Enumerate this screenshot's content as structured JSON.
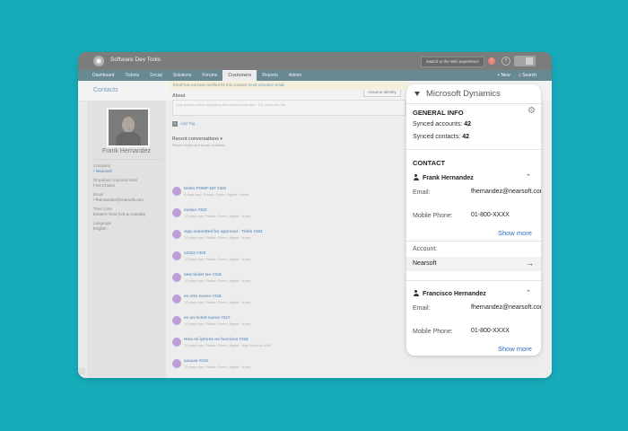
{
  "app": {
    "title": "Software Dev Tools",
    "switch_label": "Switch to the Wiki experience",
    "alert_glyph": "!",
    "help_glyph": "?"
  },
  "nav": {
    "items": [
      "Dashboard",
      "Tickets",
      "Social",
      "Solutions",
      "Forums",
      "Customers",
      "Reports",
      "Admin"
    ],
    "active": "Customers",
    "new_label": "+ New",
    "search_label": "Search"
  },
  "page": {
    "section_title": "Contacts",
    "assume_identity_label": "Assume identity"
  },
  "contact_left": {
    "name": "Frank Hernandez",
    "company_label": "Company",
    "company_value": "Nearsoft",
    "dropdown_label": "Dropdown required label",
    "dropdown_value": "First Choice",
    "email_label": "Email",
    "email_value": "fhernandez@nearsoft.com",
    "timezone_label": "Time zone",
    "timezone_value": "Eastern Time (US & Canada)",
    "language_label": "Language",
    "language_value": "English"
  },
  "main": {
    "email_warning": "Email has not been verified for this contact!",
    "email_warning_link": "Send activation email",
    "about_label": "About",
    "about_placeholder": "Add specific notes regarding this contact example - CA, takes fan etc.",
    "add_tag_label": "Add Tag",
    "recent_title": "Recent conversations",
    "recent_sub": "Recent ticket and forum activities",
    "tickets": [
      {
        "title": "testin PONP-167 #322",
        "meta": "5 days ago, Status: Open  •  Agent : None"
      },
      {
        "title": "swdas #322",
        "meta": "12 days ago, Status: Open  •  Agent : None"
      },
      {
        "title": "App submitted for approval - Trello #321",
        "meta": "12 days ago, Status: Open  •  Agent : None"
      },
      {
        "title": "s2222 #320",
        "meta": "12 days ago, Status: Open  •  Agent : None"
      },
      {
        "title": "new ticket tes #319",
        "meta": "12 days ago, Status: Open  •  Agent : None"
      },
      {
        "title": "es otro nuevo #318",
        "meta": "12 days ago, Status: Open  •  Agent : None"
      },
      {
        "title": "es un ticket nuevo #317",
        "meta": "12 days ago, Status: Open  •  Agent : None"
      },
      {
        "title": "Hola mi iphone no funciona #316",
        "meta": "12 days ago, Status: Open  •  Agent : Axel Monroy LA50"
      },
      {
        "title": "aaaaaa #315",
        "meta": "12 days ago, Status: Open  •  Agent : None"
      }
    ]
  },
  "dynamics": {
    "title": "Microsoft Dynamics",
    "general_info": "GENERAL INFO",
    "synced_accounts_label": "Synced accounts:",
    "synced_accounts_value": "42",
    "synced_contacts_label": "Synced contacts:",
    "synced_contacts_value": "42",
    "contact_header": "CONTACT",
    "contacts": [
      {
        "name": "Frank Hernandez",
        "email_label": "Email:",
        "email_value": "fhernandez@nearsoft.com",
        "phone_label": "Mobile Phone:",
        "phone_value": "01-800-XXXX",
        "show_more": "Show more",
        "account_label": "Account:",
        "account_value": "Nearsoft"
      },
      {
        "name": "Francisco Hernandez",
        "email_label": "Email:",
        "email_value": "fhernandez@nearsoft.com",
        "phone_label": "Mobile Phone:",
        "phone_value": "01-800-XXXX",
        "show_more": "Show more"
      }
    ],
    "accent_color": "#2f6bc1"
  },
  "colors": {
    "background": "#17aab9",
    "topbar": "#3b3b3b",
    "navbar": "#1d4f5c",
    "ticket_icon": "#9c6fc2"
  }
}
